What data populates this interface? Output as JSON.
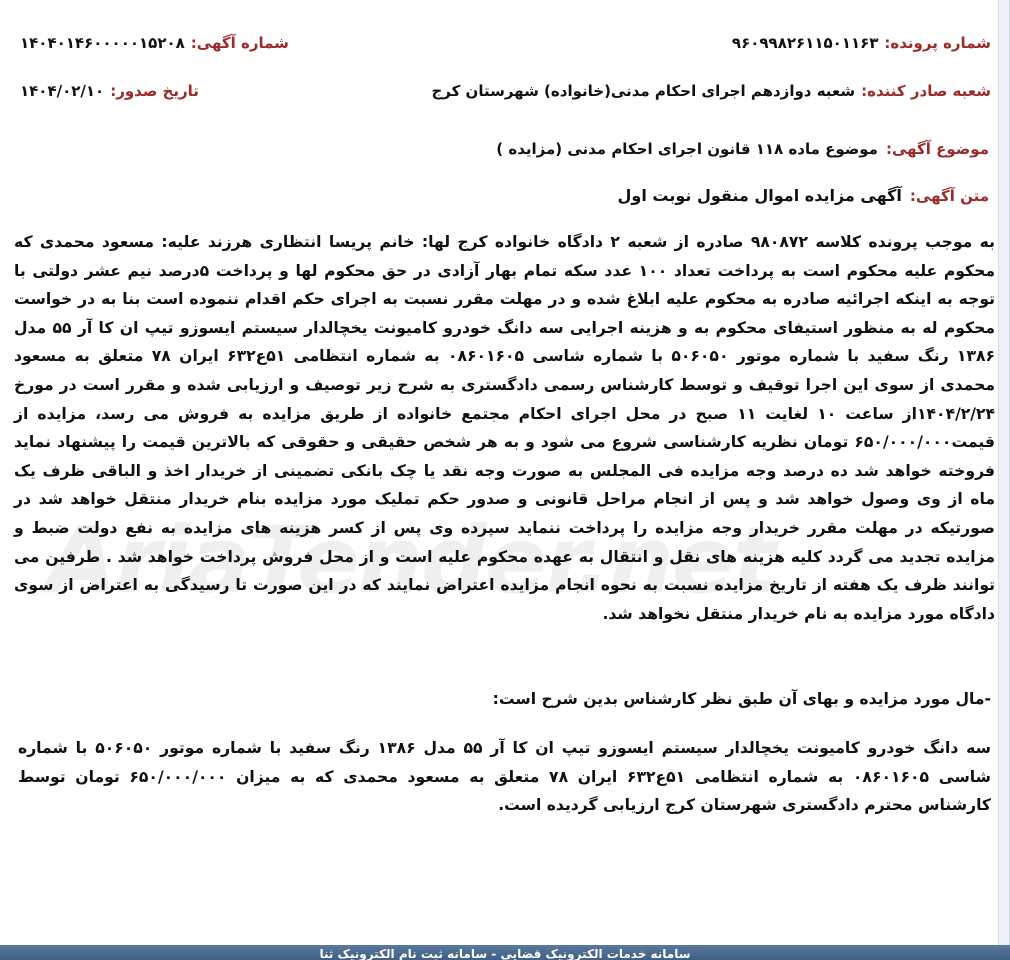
{
  "header": {
    "notice_number_label": "شماره آگهی:",
    "notice_number": "۱۴۰۴۰۱۴۶۰۰۰۰۰۱۵۲۰۸",
    "case_number_label": "شماره پرونده:",
    "case_number": "۹۶۰۹۹۸۲۶۱۱۵۰۱۱۶۳",
    "issue_date_label": "تاریخ صدور:",
    "issue_date": "۱۴۰۴/۰۲/۱۰",
    "issuing_branch_label": "شعبه صادر کننده:",
    "issuing_branch": "شعبه دوازدهم اجرای احکام مدنی(خانواده) شهرستان کرج"
  },
  "subject": {
    "label": "موضوع آگهی:",
    "value": "موضوع ماده ۱۱۸ قانون اجرای احکام مدنی (مزایده )"
  },
  "notice_text": {
    "label": "متن آگهی:",
    "value": "آگهی مزایده اموال  منقول نوبت اول"
  },
  "body": "به موجب پرونده کلاسه ۹۸۰۸۷۲  صادره از شعبه ۲ دادگاه خانواده  کرج  لها: خانم پریسا انتظاری هرزند علیه:  مسعود محمدی  که محکوم علیه محکوم است به پرداخت تعداد ۱۰۰ عدد سکه تمام بهار آزادی در حق محکوم لها و پرداخت ۵درصد نیم عشر دولتی با توجه به اینکه اجرائیه صادره به محکوم علیه ابلاغ شده و در مهلت مقرر نسبت به اجرای حکم اقدام ننموده است بنا به در خواست محکوم له به منظور استیفای محکوم به و هزینه اجرایی سه دانگ خودرو کامیونت یخچالدار سیستم ایسوزو تیپ ان کا آر ۵۵ مدل ۱۳۸۶ رنگ سفید با شماره موتور ۵۰۶۰۵۰ با شماره شاسی ۰۸۶۰۱۶۰۵  به شماره انتظامی ۵۱ع۶۳۲ ایران ۷۸ متعلق به مسعود محمدی از سوی این اجرا توقیف و توسط کارشناس رسمی دادگستری به شرح زیر توصیف و ارزیابی شده و مقرر است در مورخ ۱۴۰۴/۲/۲۴از ساعت ۱۰ لغایت ۱۱ صبح در محل اجرای احکام مجتمع خانواده از طریق مزایده به فروش می رسد، مزایده از قیمت۶۵۰/۰۰۰/۰۰۰ تومان نظریه کارشناسی شروع می شود و به هر شخص حقیقی و حقوقی که بالاترین قیمت را پیشنهاد نماید فروخته خواهد شد ده درصد وجه مزایده فی المجلس به صورت وجه نقد یا چک بانکی تضمینی از خریدار اخذ و الباقی ظرف یک ماه از وی وصول خواهد شد و پس از انجام مراحل قانونی و صدور حکم تملیک مورد مزایده بنام خریدار منتقل خواهد شد در صورتیکه در مهلت مقرر خریدار وجه مزایده را پرداخت ننماید سپرده وی پس از کسر هزینه های مزایده به نفع دولت ضبط و مزایده تجدید می گردد کلیه هزینه های نقل و انتقال به عهده محکوم علیه است و از محل فروش پرداخت خواهد شد . طرفین می توانند ظرف یک هفته از تاریخ مزایده نسبت به نحوه انجام مزایده اعتراض نمایند که در این صورت تا رسیدگی به اعتراض از سوی دادگاه مورد مزایده به نام خریدار منتقل نخواهد شد.",
  "items_heading": "-مال مورد مزایده و بهای آن طبق نظر کارشناس بدین شرح است:",
  "item_details": "سه دانگ خودرو کامیونت یخچالدار سیستم ایسوزو تیپ ان کا آر ۵۵ مدل ۱۳۸۶ رنگ سفید با شماره موتور ۵۰۶۰۵۰ با شماره شاسی ۰۸۶۰۱۶۰۵  به شماره انتظامی ۵۱ع۶۳۲ ایران ۷۸ متعلق به مسعود محمدی که  به میزان ۶۵۰/۰۰۰/۰۰۰ تومان توسط کارشناس محترم دادگستری شهرستان کرج ارزیابی گردیده است.",
  "watermark_text": "AriaTender.net",
  "footer": {
    "text": "سامانه خدمات الکترونیک قضایی - سامانه ثبت نام الکترونیک ثنا"
  },
  "colors": {
    "label": "#9b2a2a",
    "footer": "#4a6a90"
  }
}
